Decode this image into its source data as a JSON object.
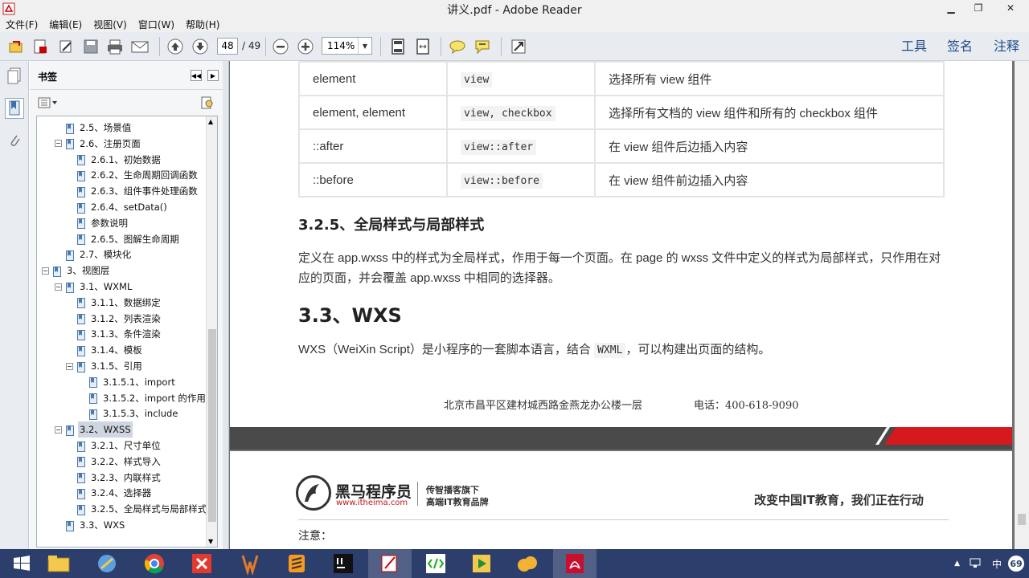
{
  "window": {
    "title": "讲义.pdf - Adobe Reader",
    "minimize": "▁",
    "restore": "❐",
    "close": "✕"
  },
  "menu": [
    "文件(F)",
    "编辑(E)",
    "视图(V)",
    "窗口(W)",
    "帮助(H)"
  ],
  "toolbar": {
    "page_current": "48",
    "page_total": "/ 49",
    "zoom": "114%"
  },
  "right_tools": {
    "tools": "工具",
    "sign": "签名",
    "comment": "注释"
  },
  "bookmarks": {
    "title": "书签",
    "items": [
      {
        "label": "2.5、场景值",
        "level": 1,
        "toggle": ""
      },
      {
        "label": "2.6、注册页面",
        "level": 1,
        "toggle": "−"
      },
      {
        "label": "2.6.1、初始数据",
        "level": 2,
        "toggle": ""
      },
      {
        "label": "2.6.2、生命周期回调函数",
        "level": 2,
        "toggle": ""
      },
      {
        "label": "2.6.3、组件事件处理函数",
        "level": 2,
        "toggle": ""
      },
      {
        "label": "2.6.4、setData()",
        "level": 2,
        "toggle": ""
      },
      {
        "label": "参数说明",
        "level": 2,
        "toggle": ""
      },
      {
        "label": "2.6.5、图解生命周期",
        "level": 2,
        "toggle": ""
      },
      {
        "label": "2.7、模块化",
        "level": 1,
        "toggle": ""
      },
      {
        "label": "3、视图层",
        "level": 0,
        "toggle": "−"
      },
      {
        "label": "3.1、WXML",
        "level": 1,
        "toggle": "−"
      },
      {
        "label": "3.1.1、数据绑定",
        "level": 2,
        "toggle": ""
      },
      {
        "label": "3.1.2、列表渲染",
        "level": 2,
        "toggle": ""
      },
      {
        "label": "3.1.3、条件渲染",
        "level": 2,
        "toggle": ""
      },
      {
        "label": "3.1.4、模板",
        "level": 2,
        "toggle": ""
      },
      {
        "label": "3.1.5、引用",
        "level": 2,
        "toggle": "−"
      },
      {
        "label": "3.1.5.1、import",
        "level": 3,
        "toggle": ""
      },
      {
        "label": "3.1.5.2、import 的作用域",
        "level": 3,
        "toggle": ""
      },
      {
        "label": "3.1.5.3、include",
        "level": 3,
        "toggle": ""
      },
      {
        "label": "3.2、WXSS",
        "level": 1,
        "toggle": "−",
        "selected": true
      },
      {
        "label": "3.2.1、尺寸单位",
        "level": 2,
        "toggle": ""
      },
      {
        "label": "3.2.2、样式导入",
        "level": 2,
        "toggle": ""
      },
      {
        "label": "3.2.3、内联样式",
        "level": 2,
        "toggle": ""
      },
      {
        "label": "3.2.4、选择器",
        "level": 2,
        "toggle": ""
      },
      {
        "label": "3.2.5、全局样式与局部样式",
        "level": 2,
        "toggle": ""
      },
      {
        "label": "3.3、WXS",
        "level": 1,
        "toggle": ""
      }
    ]
  },
  "doc": {
    "table": [
      [
        "element",
        "view",
        "选择所有 view 组件"
      ],
      [
        "element, element",
        "view, checkbox",
        "选择所有文档的 view 组件和所有的 checkbox 组件"
      ],
      [
        "::after",
        "view::after",
        "在 view 组件后边插入内容"
      ],
      [
        "::before",
        "view::before",
        "在 view 组件前边插入内容"
      ]
    ],
    "h325": "3.2.5、全局样式与局部样式",
    "para1": "定义在 app.wxss 中的样式为全局样式，作用于每一个页面。在 page 的 wxss 文件中定义的样式为局部样式，只作用在对应的页面，并会覆盖 app.wxss 中相同的选择器。",
    "h33": "3.3、WXS",
    "para2_a": "WXS（WeiXin Script）是小程序的一套脚本语言，结合",
    "para2_code": "WXML",
    "para2_b": "，可以构建出页面的结构。",
    "footer_addr": "北京市昌平区建材城西路金燕龙办公楼一层",
    "footer_phone": "电话：400-618-9090",
    "brand_name": "黑马程序员",
    "brand_url": "www.itheima.com",
    "brand_tag1": "传智播客旗下",
    "brand_tag2": "高端IT教育品牌",
    "slogan": "改变中国IT教育，我们正在行动",
    "note": "注意："
  },
  "tray": {
    "ime": "中",
    "badge": "69"
  }
}
